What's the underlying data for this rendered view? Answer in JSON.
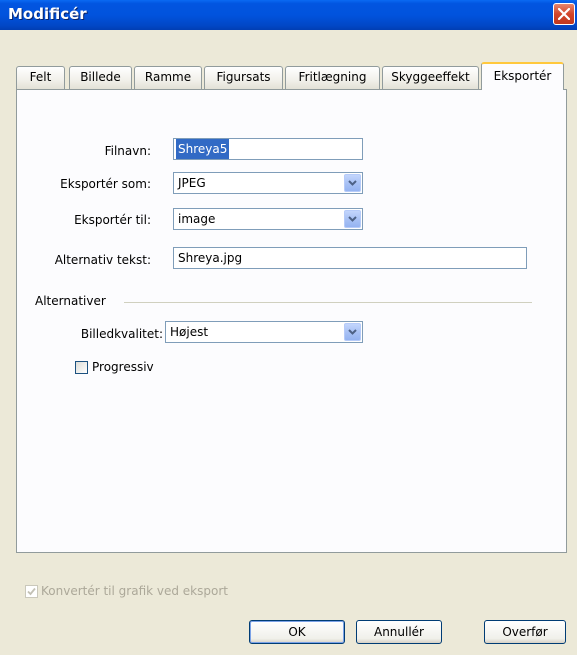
{
  "window": {
    "title": "Modificér"
  },
  "tabs": [
    {
      "label": "Felt"
    },
    {
      "label": "Billede"
    },
    {
      "label": "Ramme"
    },
    {
      "label": "Figursats"
    },
    {
      "label": "Fritlægning"
    },
    {
      "label": "Skyggeeffekt"
    },
    {
      "label": "Eksportér",
      "active": true
    }
  ],
  "form": {
    "filename_label": "Filnavn:",
    "filename_value": "Shreya5",
    "export_as_label": "Eksportér som:",
    "export_as_value": "JPEG",
    "export_to_label": "Eksportér til:",
    "export_to_value": "image",
    "alt_text_label": "Alternativ tekst:",
    "alt_text_value": "Shreya.jpg"
  },
  "options": {
    "group_label": "Alternativer",
    "quality_label": "Billedkvalitet:",
    "quality_value": "Højest",
    "progressive_label": "Progressiv",
    "progressive_checked": false
  },
  "footer": {
    "convert_label": "Konvertér til grafik ved eksport",
    "convert_checked": true,
    "convert_disabled": true,
    "ok_label": "OK",
    "cancel_label": "Annullér",
    "apply_label": "Overfør"
  },
  "colors": {
    "titlebar": "#0153dd",
    "dialog_bg": "#ece9d8",
    "selection": "#316ac5",
    "active_tab_accent": "#ffc83c"
  }
}
